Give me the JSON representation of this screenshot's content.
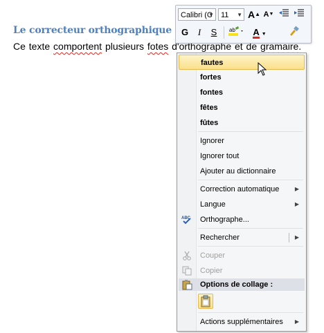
{
  "document": {
    "title": "Le correcteur orthographique",
    "sentence_parts": [
      "Ce texte ",
      "comportent",
      " plusieurs ",
      "fotes",
      " d'orthographe  et de ",
      "gramaire",
      "."
    ]
  },
  "mini_toolbar": {
    "font_name": "Calibri (C",
    "font_size": "11",
    "bold": "G",
    "italic": "I",
    "underline": "S",
    "grow_font": "A",
    "shrink_font": "A",
    "font_color_letter": "A"
  },
  "menu": {
    "suggestions": [
      "fautes",
      "fortes",
      "fontes",
      "fêtes",
      "fûtes"
    ],
    "ignore": "Ignorer",
    "ignore_all": "Ignorer tout",
    "add_dictionary": "Ajouter au dictionnaire",
    "autocorrect": "Correction automatique",
    "language": "Langue",
    "spelling": "Orthographe...",
    "search": "Rechercher",
    "cut": "Couper",
    "copy": "Copier",
    "paste_options": "Options de collage :",
    "more_actions": "Actions supplémentaires"
  },
  "colors": {
    "title": "#4f81bd",
    "squiggle": "#e0241a",
    "highlight": "#fbe08c"
  }
}
